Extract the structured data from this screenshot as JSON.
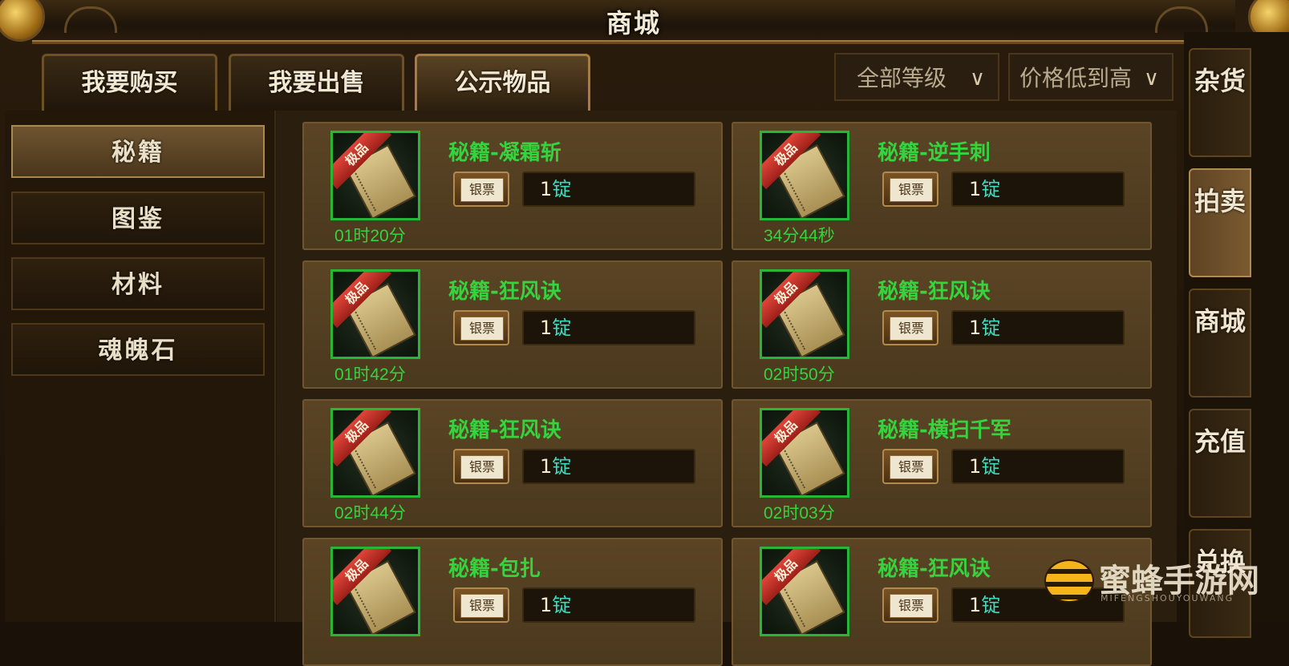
{
  "window": {
    "title": "商城"
  },
  "tabs": [
    {
      "label": "我要购买"
    },
    {
      "label": "我要出售"
    },
    {
      "label": "公示物品",
      "active": true
    }
  ],
  "filters": {
    "level": {
      "value": "全部等级"
    },
    "sort": {
      "value": "价格低到高"
    }
  },
  "categories": [
    {
      "label": "秘籍",
      "active": true
    },
    {
      "label": "图鉴"
    },
    {
      "label": "材料"
    },
    {
      "label": "魂魄石"
    }
  ],
  "items": [
    {
      "name": "秘籍-凝霜斩",
      "badge": "极品",
      "currency": "银票",
      "price_num": "1",
      "price_unit": "锭",
      "timer": "01时20分"
    },
    {
      "name": "秘籍-逆手刺",
      "badge": "极品",
      "currency": "银票",
      "price_num": "1",
      "price_unit": "锭",
      "timer": "34分44秒"
    },
    {
      "name": "秘籍-狂风诀",
      "badge": "极品",
      "currency": "银票",
      "price_num": "1",
      "price_unit": "锭",
      "timer": "01时42分"
    },
    {
      "name": "秘籍-狂风诀",
      "badge": "极品",
      "currency": "银票",
      "price_num": "1",
      "price_unit": "锭",
      "timer": "02时50分"
    },
    {
      "name": "秘籍-狂风诀",
      "badge": "极品",
      "currency": "银票",
      "price_num": "1",
      "price_unit": "锭",
      "timer": "02时44分"
    },
    {
      "name": "秘籍-横扫千军",
      "badge": "极品",
      "currency": "银票",
      "price_num": "1",
      "price_unit": "锭",
      "timer": "02时03分"
    },
    {
      "name": "秘籍-包扎",
      "badge": "极品",
      "currency": "银票",
      "price_num": "1",
      "price_unit": "锭",
      "timer": ""
    },
    {
      "name": "秘籍-狂风诀",
      "badge": "极品",
      "currency": "银票",
      "price_num": "1",
      "price_unit": "锭",
      "timer": ""
    }
  ],
  "side_nav": [
    {
      "label": "杂货"
    },
    {
      "label": "拍卖",
      "active": true
    },
    {
      "label": "商城"
    },
    {
      "label": "充值"
    },
    {
      "label": "兑换"
    }
  ],
  "watermark": {
    "text": "蜜蜂手游网",
    "sub": "MIFENGSHOUYOUWANG"
  },
  "colors": {
    "item_name": "#35d33e",
    "price_unit": "#3fd9c0",
    "badge": "#d63a2f",
    "icon_border": "#27b636"
  }
}
